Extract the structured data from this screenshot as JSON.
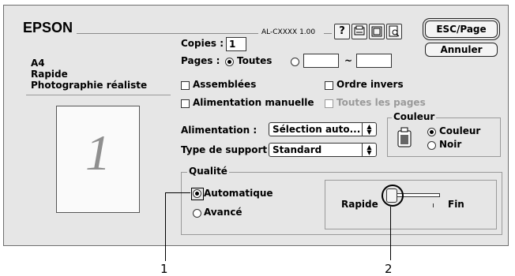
{
  "header": {
    "brand": "EPSON",
    "model": "AL-CXXXX 1.00",
    "icons": [
      "help-icon",
      "printer-settings-icon",
      "layout-icon",
      "preview-icon"
    ],
    "esc_page_label": "ESC/Page",
    "cancel_label": "Annuler"
  },
  "summary": {
    "paper": "A4",
    "speed": "Rapide",
    "media": "Photographie réaliste",
    "page_number": "1"
  },
  "copies": {
    "label": "Copies :",
    "value": "1"
  },
  "pages": {
    "label": "Pages :",
    "all_label": "Toutes",
    "all_selected": true,
    "from": "",
    "to": "",
    "range_sep": "~"
  },
  "options": {
    "collate": "Assemblées",
    "reverse": "Ordre invers",
    "manual_feed": "Alimentation manuelle",
    "all_pages": "Toutes les pages"
  },
  "source": {
    "label": "Alimentation :",
    "value": "Sélection auto..."
  },
  "media_type": {
    "label": "Type de support :",
    "value": "Standard"
  },
  "color": {
    "title": "Couleur",
    "color_label": "Couleur",
    "mono_label": "Noir",
    "selected": "Couleur"
  },
  "quality": {
    "title": "Qualité",
    "auto_label": "Automatique",
    "advanced_label": "Avancé",
    "selected": "Automatique"
  },
  "slider": {
    "left_label": "Rapide",
    "right_label": "Fin",
    "level": 0
  },
  "callouts": {
    "one": "1",
    "two": "2"
  },
  "colors": {
    "dialog_bg": "#e6e6e6",
    "border": "#333333"
  }
}
